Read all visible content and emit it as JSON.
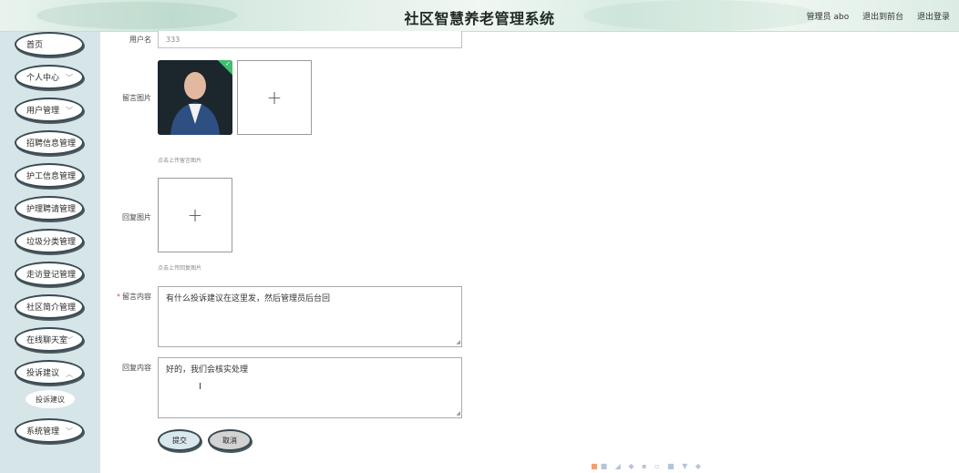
{
  "header": {
    "title": "社区智慧养老管理系统",
    "user_label": "管理员 abo",
    "front_link": "退出到前台",
    "logout_link": "退出登录"
  },
  "sidebar": {
    "items": [
      {
        "label": "首页",
        "has_chevron": false
      },
      {
        "label": "个人中心",
        "has_chevron": true
      },
      {
        "label": "用户管理",
        "has_chevron": true
      },
      {
        "label": "招聘信息管理",
        "has_chevron": false
      },
      {
        "label": "护工信息管理",
        "has_chevron": false
      },
      {
        "label": "护理聘请管理",
        "has_chevron": false
      },
      {
        "label": "垃圾分类管理",
        "has_chevron": false
      },
      {
        "label": "走访登记管理",
        "has_chevron": false
      },
      {
        "label": "社区简介管理",
        "has_chevron": false
      },
      {
        "label": "在线聊天室",
        "has_chevron": true
      },
      {
        "label": "投诉建议",
        "has_chevron": true
      },
      {
        "label": "系统管理",
        "has_chevron": true
      }
    ],
    "sub_item": "投诉建议"
  },
  "form": {
    "username_label": "用户名",
    "username_value": "333",
    "message_image_label": "留言图片",
    "message_image_hint": "点击上传留言图片",
    "reply_image_label": "回复图片",
    "reply_image_hint": "点击上传回复图片",
    "message_content_label": "留言内容",
    "message_content_value": "有什么投诉建议在这里发，然后管理员后台回",
    "reply_content_label": "回复内容",
    "reply_content_value": "好的，我们会核实处理",
    "submit_label": "提交",
    "cancel_label": "取消"
  },
  "icons": {
    "plus": "+",
    "chevron": "﹀",
    "check": "✓",
    "resize": "◢"
  },
  "colors": {
    "sidebar_bg": "#d6e5e8",
    "success_corner": "#3fbf6f",
    "button_border": "#3a4a52"
  }
}
